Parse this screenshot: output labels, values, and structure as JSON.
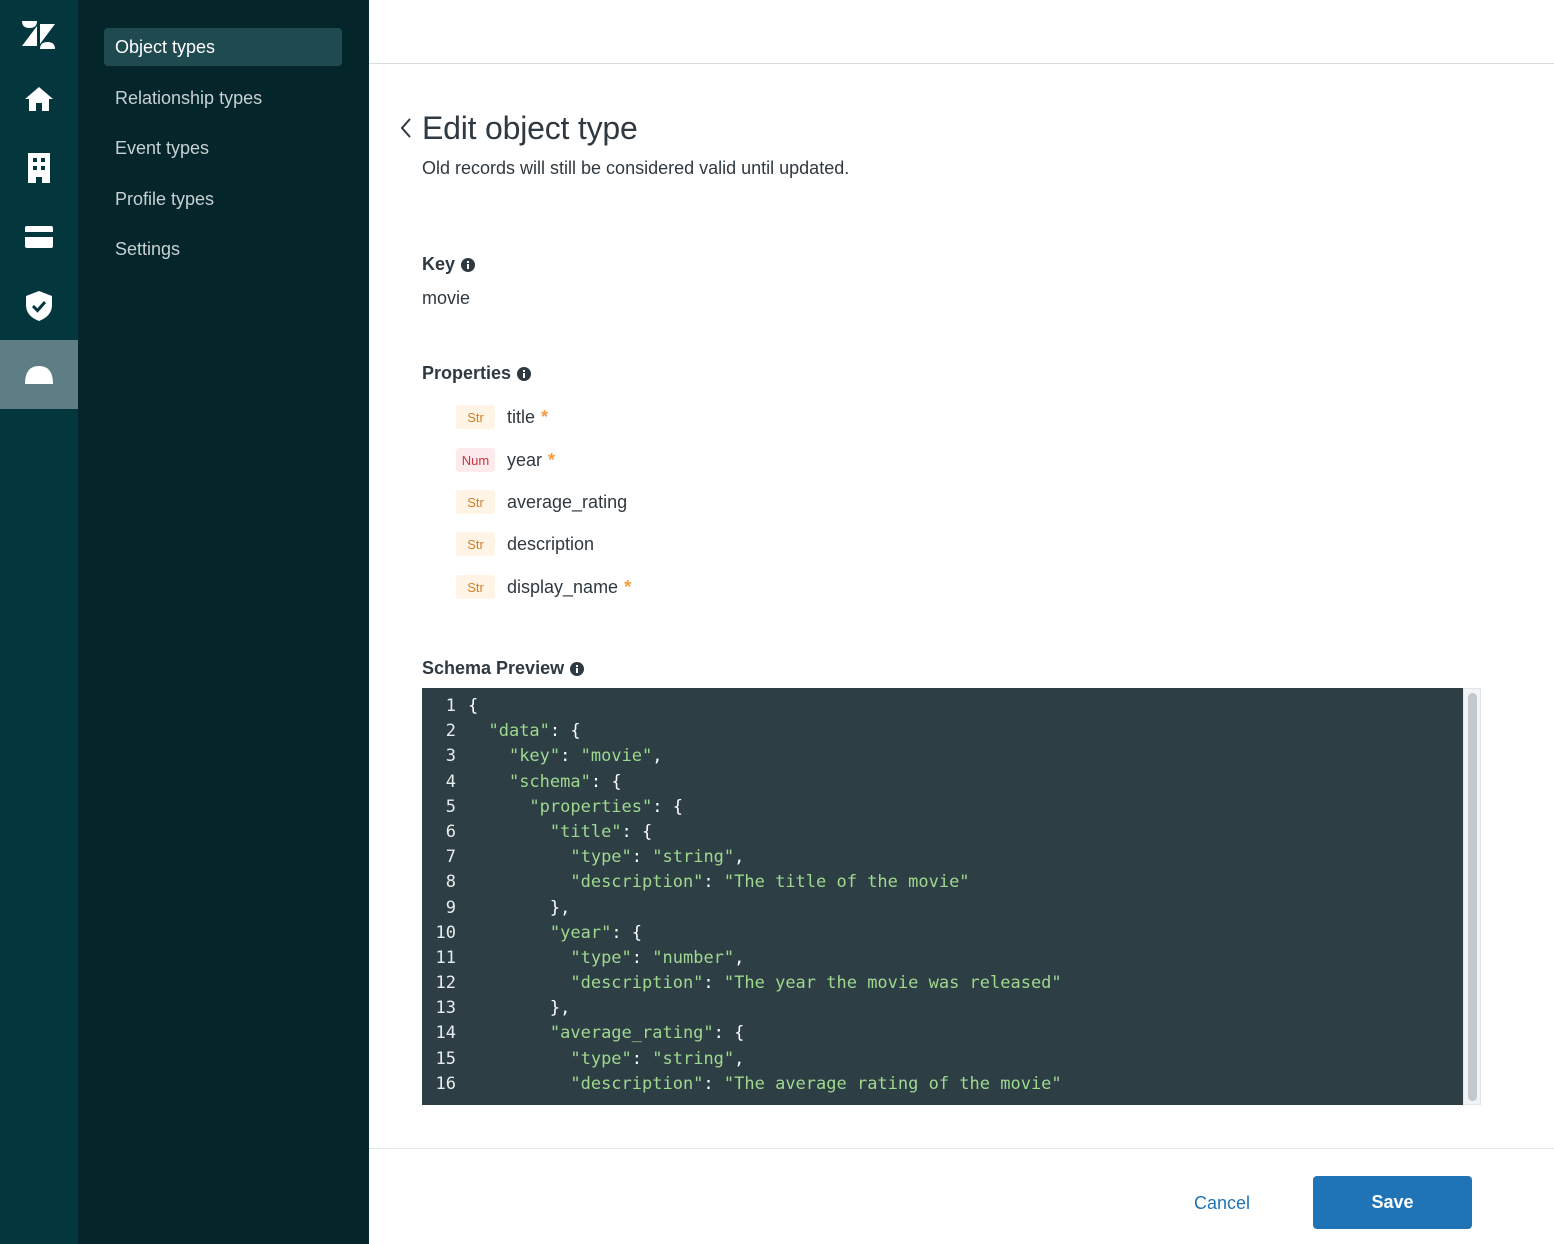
{
  "rail": {
    "items": [
      {
        "icon": "zendesk-logo-icon"
      },
      {
        "icon": "home-icon"
      },
      {
        "icon": "building-icon"
      },
      {
        "icon": "card-icon"
      },
      {
        "icon": "shield-icon"
      },
      {
        "icon": "dome-icon",
        "active": true
      }
    ],
    "colors": {
      "background": "#03363d",
      "active": "#5d7e84"
    }
  },
  "subnav": {
    "items": [
      {
        "label": "Object types",
        "active": true
      },
      {
        "label": "Relationship types"
      },
      {
        "label": "Event types"
      },
      {
        "label": "Profile types"
      },
      {
        "label": "Settings"
      }
    ]
  },
  "page": {
    "title": "Edit object type",
    "subtitle": "Old records will still be considered valid until updated."
  },
  "key": {
    "label": "Key",
    "value": "movie"
  },
  "properties": {
    "label": "Properties",
    "items": [
      {
        "type": "Str",
        "name": "title",
        "required": true
      },
      {
        "type": "Num",
        "name": "year",
        "required": true
      },
      {
        "type": "Str",
        "name": "average_rating",
        "required": false
      },
      {
        "type": "Str",
        "name": "description",
        "required": false
      },
      {
        "type": "Str",
        "name": "display_name",
        "required": true
      }
    ],
    "required_marker": "*"
  },
  "schema_preview": {
    "label": "Schema Preview",
    "lines": [
      "{",
      "  \"data\": {",
      "    \"key\": \"movie\",",
      "    \"schema\": {",
      "      \"properties\": {",
      "        \"title\": {",
      "          \"type\": \"string\",",
      "          \"description\": \"The title of the movie\"",
      "        },",
      "        \"year\": {",
      "          \"type\": \"number\",",
      "          \"description\": \"The year the movie was released\"",
      "        },",
      "        \"average_rating\": {",
      "          \"type\": \"string\",",
      "          \"description\": \"The average rating of the movie\""
    ]
  },
  "footer": {
    "cancel_label": "Cancel",
    "save_label": "Save"
  },
  "colors": {
    "accent": "#1f73b7",
    "code_bg": "#2d3e45",
    "code_string": "#9fd88f",
    "badge_str": "#d27f26",
    "badge_num": "#cc3340",
    "required": "#f79a3e"
  }
}
